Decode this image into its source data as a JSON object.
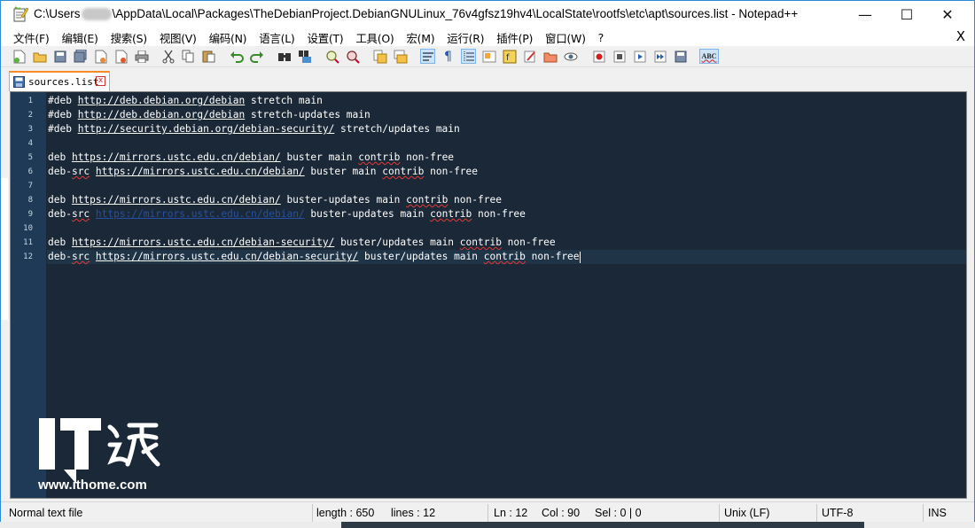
{
  "window": {
    "title_prefix": "C:\\Users",
    "title_suffix": "\\AppData\\Local\\Packages\\TheDebianProject.DebianGNULinux_76v4gfsz19hv4\\LocalState\\rootfs\\etc\\apt\\sources.list - Notepad++",
    "minimize_label": "—",
    "maximize_label": "☐",
    "close_label": "✕"
  },
  "menu": {
    "items": [
      {
        "label": "文件(F)"
      },
      {
        "label": "编辑(E)"
      },
      {
        "label": "搜索(S)"
      },
      {
        "label": "视图(V)"
      },
      {
        "label": "编码(N)"
      },
      {
        "label": "语言(L)"
      },
      {
        "label": "设置(T)"
      },
      {
        "label": "工具(O)"
      },
      {
        "label": "宏(M)"
      },
      {
        "label": "运行(R)"
      },
      {
        "label": "插件(P)"
      },
      {
        "label": "窗口(W)"
      },
      {
        "label": "?"
      }
    ],
    "close_doc_label": "X"
  },
  "toolbar": {
    "icons": [
      "new-file-icon",
      "open-file-icon",
      "save-icon",
      "save-all-icon",
      "close-icon",
      "close-all-icon",
      "print-icon",
      "cut-icon",
      "copy-icon",
      "paste-icon",
      "undo-icon",
      "redo-icon",
      "find-icon",
      "replace-icon",
      "zoom-in-icon",
      "zoom-out-icon",
      "sync-vertical-icon",
      "sync-horizontal-icon",
      "word-wrap-icon",
      "show-all-chars-icon",
      "indent-guide-icon",
      "document-map-icon",
      "function-list-icon",
      "folder-workspace-icon",
      "user-lang-icon",
      "monitor-icon",
      "record-macro-icon",
      "stop-record-icon",
      "play-macro-icon",
      "run-macro-multiple-icon",
      "save-macro-icon",
      "spell-check-icon"
    ],
    "spell_check_label": "ABC"
  },
  "tab": {
    "label": "sources.list",
    "close_label": "x"
  },
  "editor": {
    "lines": [
      {
        "num": "1",
        "segments": [
          {
            "t": "#deb "
          },
          {
            "t": "http://deb.debian.org/debian",
            "u": 1
          },
          {
            "t": " stretch main"
          }
        ]
      },
      {
        "num": "2",
        "segments": [
          {
            "t": "#deb "
          },
          {
            "t": "http://deb.debian.org/debian",
            "u": 1
          },
          {
            "t": " stretch-updates main"
          }
        ]
      },
      {
        "num": "3",
        "segments": [
          {
            "t": "#deb "
          },
          {
            "t": "http://security.debian.org/debian-security/",
            "u": 1
          },
          {
            "t": " stretch/updates main"
          }
        ]
      },
      {
        "num": "4",
        "segments": []
      },
      {
        "num": "5",
        "segments": [
          {
            "t": "deb "
          },
          {
            "t": "https://mirrors.ustc.edu.cn/debian/",
            "u": 1
          },
          {
            "t": " buster main "
          },
          {
            "t": "contrib",
            "s": 1
          },
          {
            "t": " non-free"
          }
        ]
      },
      {
        "num": "6",
        "segments": [
          {
            "t": "deb-"
          },
          {
            "t": "src",
            "s": 1
          },
          {
            "t": " "
          },
          {
            "t": "https://mirrors.ustc.edu.cn/debian/",
            "u": 1
          },
          {
            "t": " buster main "
          },
          {
            "t": "contrib",
            "s": 1
          },
          {
            "t": " non-free"
          }
        ]
      },
      {
        "num": "7",
        "segments": []
      },
      {
        "num": "8",
        "segments": [
          {
            "t": "deb "
          },
          {
            "t": "https://mirrors.ustc.edu.cn/debian/",
            "u": 1
          },
          {
            "t": " buster-updates main "
          },
          {
            "t": "contrib",
            "s": 1
          },
          {
            "t": " non-free"
          }
        ]
      },
      {
        "num": "9",
        "segments": [
          {
            "t": "deb-"
          },
          {
            "t": "src",
            "s": 1
          },
          {
            "t": " "
          },
          {
            "t": "https://mirrors.ustc.edu.cn/debian/",
            "u": 2
          },
          {
            "t": " buster-updates main "
          },
          {
            "t": "contrib",
            "s": 1
          },
          {
            "t": " non-free"
          }
        ]
      },
      {
        "num": "10",
        "segments": []
      },
      {
        "num": "11",
        "segments": [
          {
            "t": "deb "
          },
          {
            "t": "https://mirrors.ustc.edu.cn/debian-security/",
            "u": 1
          },
          {
            "t": " buster/updates main "
          },
          {
            "t": "contrib",
            "s": 1
          },
          {
            "t": " non-free"
          }
        ]
      },
      {
        "num": "12",
        "segments": [
          {
            "t": "deb-"
          },
          {
            "t": "src",
            "s": 1
          },
          {
            "t": " "
          },
          {
            "t": "https://mirrors.ustc.edu.cn/debian-security/",
            "u": 1
          },
          {
            "t": " buster/updates main "
          },
          {
            "t": "contrib",
            "s": 1
          },
          {
            "t": " non-free"
          }
        ]
      }
    ],
    "current_line": 12
  },
  "watermark": {
    "logo_text": "IT之家",
    "url": "www.ithome.com"
  },
  "status": {
    "file_type": "Normal text file",
    "length": "length : 650",
    "lines": "lines : 12",
    "ln": "Ln : 12",
    "col": "Col : 90",
    "sel": "Sel : 0 | 0",
    "eol": "Unix (LF)",
    "encoding": "UTF-8",
    "mode": "INS"
  },
  "colors": {
    "editor_bg": "#1a2837",
    "gutter_bg": "#1e3a56",
    "tab_accent": "#fa8c27",
    "squiggle": "#e53935"
  }
}
